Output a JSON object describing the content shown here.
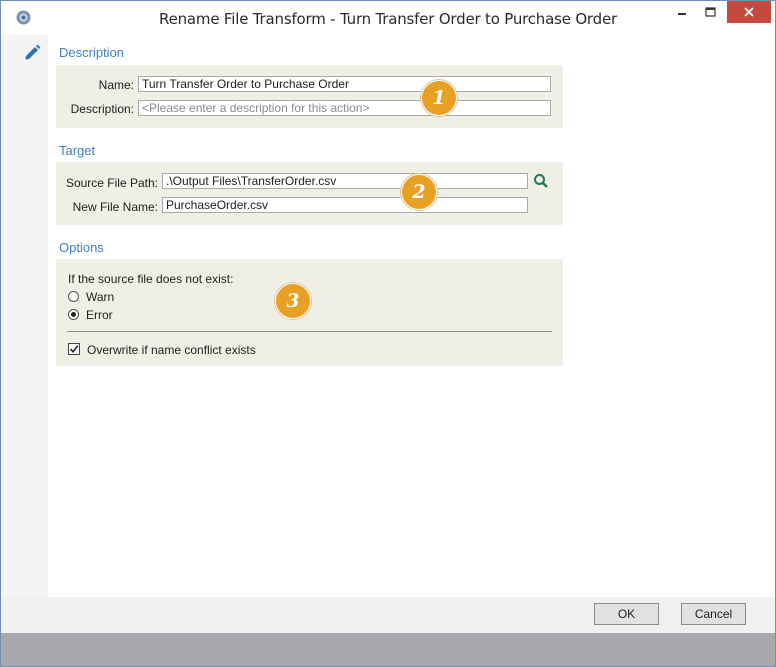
{
  "window": {
    "title": "Rename File Transform - Turn Transfer Order to Purchase Order",
    "controls": {
      "minimize": "minimize",
      "maximize": "maximize",
      "close": "close"
    }
  },
  "description_section": {
    "heading": "Description",
    "name_label": "Name:",
    "name_value": "Turn Transfer Order to Purchase Order",
    "description_label": "Description:",
    "description_placeholder": "<Please enter a description for this action>",
    "badge": "1"
  },
  "target_section": {
    "heading": "Target",
    "source_label": "Source File Path:",
    "source_value": ".\\Output Files\\TransferOrder.csv",
    "new_name_label": "New File Name:",
    "new_name_value": "PurchaseOrder.csv",
    "badge": "2"
  },
  "options_section": {
    "heading": "Options",
    "prompt": "If the source file does not exist:",
    "radios": [
      {
        "label": "Warn",
        "selected": false
      },
      {
        "label": "Error",
        "selected": true
      }
    ],
    "overwrite_label": "Overwrite if name conflict exists",
    "overwrite_checked": true,
    "badge": "3"
  },
  "buttons": {
    "ok": "OK",
    "cancel": "Cancel"
  },
  "colors": {
    "accent": "#3b7fc4",
    "badge": "#e8a024",
    "panel": "#f0efe6",
    "close": "#c7483f"
  },
  "icons": [
    "app-icon",
    "edit-pencil-icon",
    "search-icon",
    "minimize-icon",
    "maximize-icon",
    "close-icon"
  ]
}
